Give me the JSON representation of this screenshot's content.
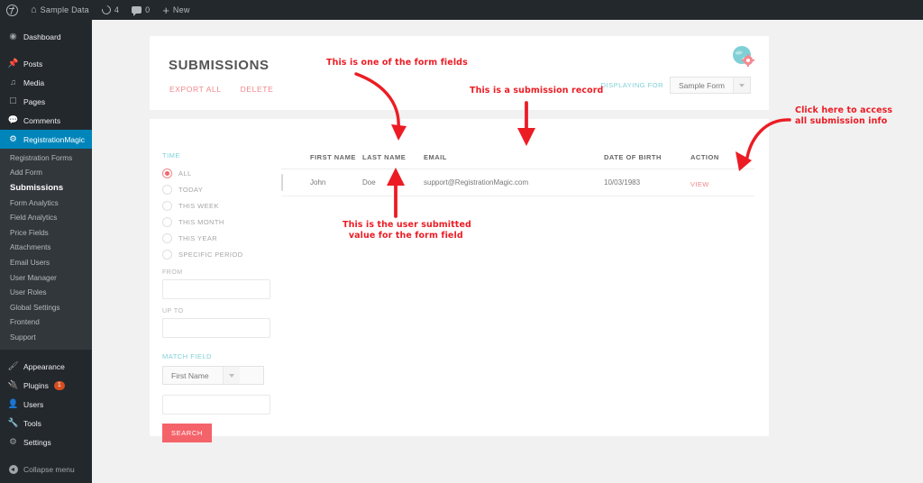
{
  "adminbar": {
    "items": [
      {
        "icon": "wordpress-logo-icon",
        "label": ""
      },
      {
        "icon": "home-icon",
        "label": "Sample Data"
      },
      {
        "icon": "refresh-icon",
        "label": "4"
      },
      {
        "icon": "comment-icon",
        "label": "0"
      },
      {
        "icon": "plus-icon",
        "label": "New"
      }
    ]
  },
  "sidebar": {
    "items": [
      {
        "label": "Dashboard",
        "icon": "dashboard-icon"
      },
      {
        "label": "Posts",
        "icon": "pin-icon"
      },
      {
        "label": "Media",
        "icon": "media-icon"
      },
      {
        "label": "Pages",
        "icon": "page-icon"
      },
      {
        "label": "Comments",
        "icon": "comment-icon"
      },
      {
        "label": "RegistrationMagic",
        "icon": "registrationmagic-icon",
        "current": true
      }
    ],
    "submenu": [
      {
        "label": "Registration Forms"
      },
      {
        "label": "Add Form"
      },
      {
        "label": "Submissions",
        "current": true
      },
      {
        "label": "Form Analytics"
      },
      {
        "label": "Field Analytics"
      },
      {
        "label": "Price Fields"
      },
      {
        "label": "Attachments"
      },
      {
        "label": "Email Users"
      },
      {
        "label": "User Manager"
      },
      {
        "label": "User Roles"
      },
      {
        "label": "Global Settings"
      },
      {
        "label": "Frontend"
      },
      {
        "label": "Support"
      }
    ],
    "bottom_items": [
      {
        "label": "Appearance",
        "icon": "brush-icon"
      },
      {
        "label": "Plugins",
        "icon": "plug-icon",
        "badge": "1"
      },
      {
        "label": "Users",
        "icon": "user-icon"
      },
      {
        "label": "Tools",
        "icon": "wrench-icon"
      },
      {
        "label": "Settings",
        "icon": "settings-icon"
      }
    ],
    "collapse_label": "Collapse menu"
  },
  "header": {
    "title": "SUBMISSIONS",
    "export_all_label": "EXPORT ALL",
    "delete_label": "DELETE",
    "displaying_for_label": "DISPLAYING FOR",
    "form_select_value": "Sample Form"
  },
  "filters": {
    "time_label": "TIME",
    "time_options": [
      {
        "label": "ALL",
        "selected": true
      },
      {
        "label": "TODAY",
        "selected": false
      },
      {
        "label": "THIS WEEK",
        "selected": false
      },
      {
        "label": "THIS MONTH",
        "selected": false
      },
      {
        "label": "THIS YEAR",
        "selected": false
      },
      {
        "label": "SPECIFIC PERIOD",
        "selected": false
      }
    ],
    "from_label": "FROM",
    "from_value": "",
    "upto_label": "UP TO",
    "upto_value": "",
    "match_field_label": "MATCH FIELD",
    "match_field_value": "First Name",
    "match_text_value": "",
    "search_label": "SEARCH"
  },
  "table": {
    "columns": [
      "FIRST NAME",
      "LAST NAME",
      "EMAIL",
      "DATE OF BIRTH",
      "ACTION"
    ],
    "rows": [
      {
        "first_name": "John",
        "last_name": "Doe",
        "email": "support@RegistrationMagic.com",
        "date_of_birth": "10/03/1983",
        "action": "VIEW"
      }
    ]
  },
  "annotations": [
    {
      "text": "This is one of the form fields"
    },
    {
      "text": "This is a submission record"
    },
    {
      "text": "This is the user submitted\n  value for the form field"
    },
    {
      "text": "Click here to access\nall submission info"
    }
  ],
  "colors": {
    "admin_dark": "#23282d",
    "submenu_dark": "#32373c",
    "current_blue": "#0085ba",
    "accent_red": "#f5636a",
    "link_pink": "#f1868c",
    "label_teal": "#7fd0d6",
    "annotation_red": "#ec1c24",
    "badge_orange": "#d54e21"
  }
}
